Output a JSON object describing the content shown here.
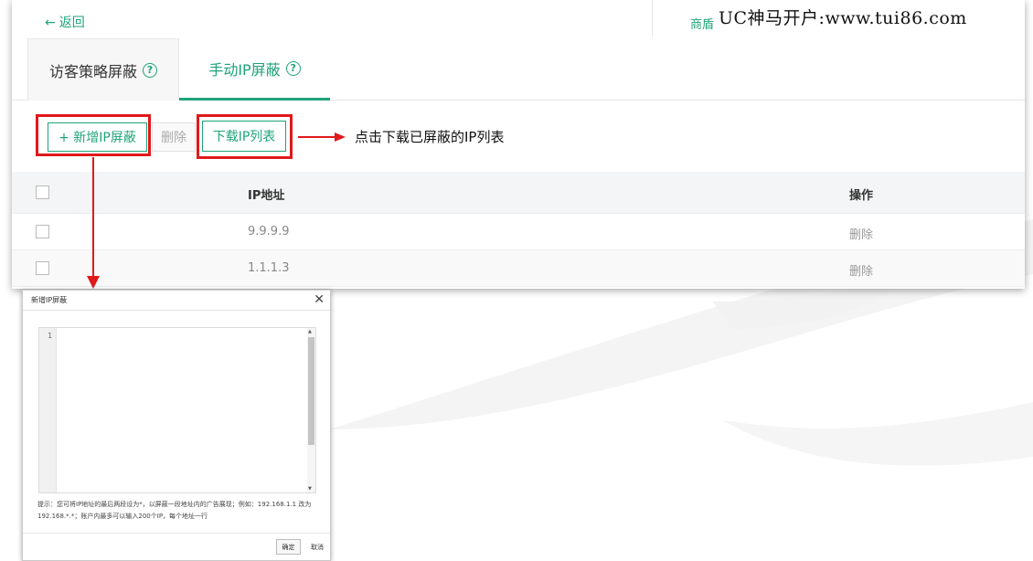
{
  "header": {
    "back_label": "返回",
    "right_tab_label": "商盾"
  },
  "watermark": "UC神马开户:www.tui86.com",
  "tabs": [
    {
      "label": "访客策略屏蔽",
      "active": false
    },
    {
      "label": "手动IP屏蔽",
      "active": true
    }
  ],
  "toolbar": {
    "add_label": "+ 新增IP屏蔽",
    "delete_label": "删除",
    "download_label": "下载IP列表"
  },
  "annotation": {
    "text": "点击下载已屏蔽的IP列表"
  },
  "table": {
    "columns": {
      "ip": "IP地址",
      "op": "操作"
    },
    "rows": [
      {
        "ip": "9.9.9.9",
        "op": "删除"
      },
      {
        "ip": "1.1.1.3",
        "op": "删除"
      }
    ]
  },
  "dialog": {
    "title": "新增IP屏蔽",
    "line_number": "1",
    "tip": "提示：您可将IP地址的最后两段设为*，以屏蔽一段地址内的广告展现；例如：192.168.1.1 改为 192.168.*.*；账户内最多可以输入200个IP，每个地址一行",
    "ok_label": "确定",
    "cancel_label": "取消"
  },
  "colors": {
    "accent": "#1fa37a",
    "highlight": "#e0191b"
  }
}
